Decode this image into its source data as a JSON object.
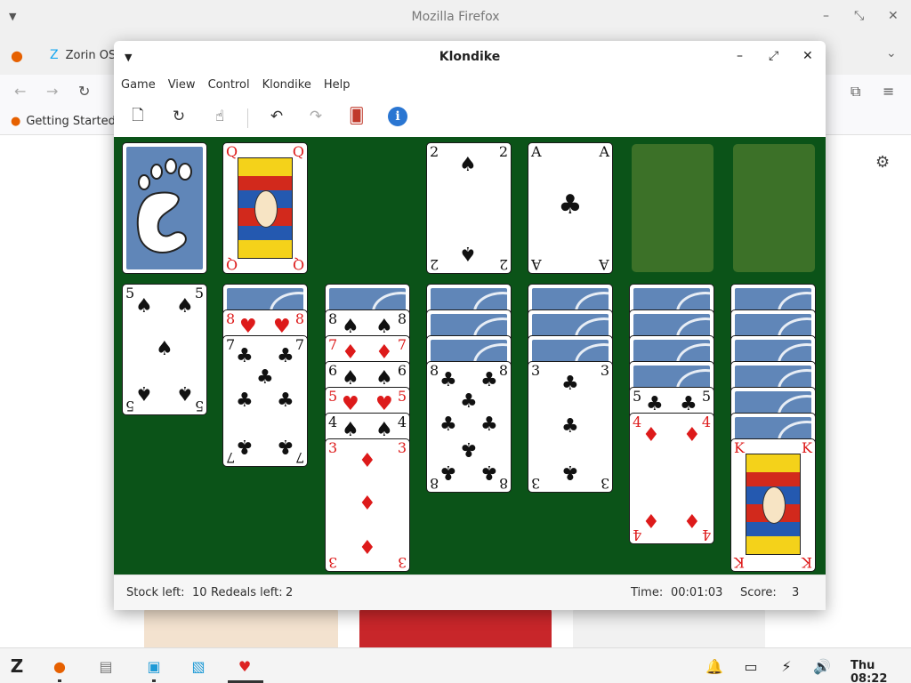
{
  "firefox": {
    "title": "Mozilla Firefox",
    "tab_label": "Zorin OS",
    "bookmark_label": "Getting Started"
  },
  "klondike": {
    "title": "Klondike",
    "menu": [
      "Game",
      "View",
      "Control",
      "Klondike",
      "Help"
    ],
    "toolbar": {
      "new_game": "new-game-icon",
      "restart": "restart-icon",
      "hint": "hint-icon",
      "undo": "undo-icon",
      "redo": "redo-icon",
      "deal": "deal-icon",
      "info": "i"
    },
    "stock": {
      "label": "Stock left:",
      "value": "10"
    },
    "redeals": {
      "label": "Redeals left:",
      "value": "2"
    },
    "time": {
      "label": "Time:",
      "value": "00:01:03"
    },
    "score": {
      "label": "Score:",
      "value": "3"
    },
    "colors": {
      "felt": "#0b5318",
      "slot": "#3c7128",
      "card_back": "#6086b8",
      "red_suit": "#dd1a1a"
    },
    "top_row": {
      "waste": {
        "rank": "Q",
        "suit": "♦",
        "color": "red"
      },
      "foundation1": {
        "rank": "2",
        "suit": "♠",
        "color": "blk"
      },
      "foundation2": {
        "rank": "A",
        "suit": "♣",
        "color": "blk"
      }
    },
    "tableau": [
      {
        "col": 1,
        "cards": [
          {
            "rank": "5",
            "suit": "♠",
            "color": "blk"
          }
        ]
      },
      {
        "col": 2,
        "cards": [
          {
            "rank": "8",
            "suit": "♥",
            "color": "red"
          },
          {
            "rank": "7",
            "suit": "♣",
            "color": "blk"
          }
        ]
      },
      {
        "col": 3,
        "cards": [
          {
            "rank": "8",
            "suit": "♠",
            "color": "blk"
          },
          {
            "rank": "7",
            "suit": "♦",
            "color": "red"
          },
          {
            "rank": "6",
            "suit": "♠",
            "color": "blk"
          },
          {
            "rank": "5",
            "suit": "♥",
            "color": "red"
          },
          {
            "rank": "4",
            "suit": "♠",
            "color": "blk"
          },
          {
            "rank": "3",
            "suit": "♦",
            "color": "red"
          }
        ]
      },
      {
        "col": 4,
        "cards": [
          {
            "rank": "8",
            "suit": "♣",
            "color": "blk"
          }
        ]
      },
      {
        "col": 5,
        "cards": [
          {
            "rank": "3",
            "suit": "♣",
            "color": "blk"
          }
        ]
      },
      {
        "col": 6,
        "cards": [
          {
            "rank": "5",
            "suit": "♣",
            "color": "blk"
          },
          {
            "rank": "4",
            "suit": "♦",
            "color": "red"
          }
        ]
      },
      {
        "col": 7,
        "cards": [
          {
            "rank": "K",
            "suit": "♦",
            "color": "red"
          }
        ]
      }
    ]
  },
  "taskbar": {
    "clock": "Thu 08:22"
  }
}
